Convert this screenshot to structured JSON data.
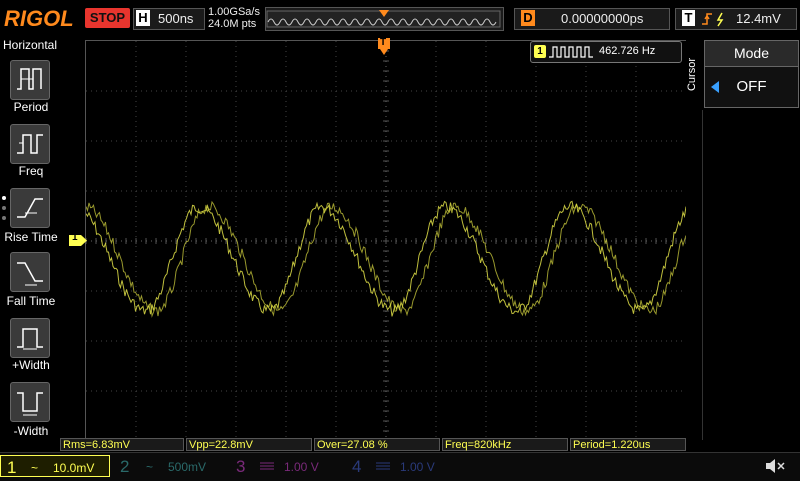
{
  "top": {
    "logo": "RIGOL",
    "run_state": "STOP",
    "timebase_label": "H",
    "timebase_value": "500ns",
    "sample_rate": "1.00GSa/s",
    "memory_points": "24.0M pts",
    "delay_label": "D",
    "delay_value": "0.00000000ps",
    "trigger_label": "T",
    "trigger_level": "12.4mV"
  },
  "menu": {
    "title": "Horizontal",
    "items": [
      {
        "label": "Period"
      },
      {
        "label": "Freq"
      },
      {
        "label": "Rise Time"
      },
      {
        "label": "Fall Time"
      },
      {
        "label": "+Width"
      },
      {
        "label": "-Width"
      }
    ]
  },
  "right_panel": {
    "vertical_label": "Cursor",
    "mode_title": "Mode",
    "mode_value": "OFF"
  },
  "freq_counter": {
    "channel": "1",
    "value": "462.726 Hz"
  },
  "markers": {
    "trigger_pos": "T",
    "ch1_ground": "1",
    "trigger_level_marker": "T"
  },
  "measurements": [
    "Rms=6.83mV",
    "Vpp=22.8mV",
    "Over=27.08 %",
    "Freq=820kHz",
    "Period=1.220us"
  ],
  "channels": [
    {
      "num": "1",
      "coupling": "~",
      "scale": "10.0mV",
      "color": "#ffff52"
    },
    {
      "num": "2",
      "coupling": "~",
      "scale": "500mV",
      "color": "#2a6a6a"
    },
    {
      "num": "3",
      "coupling": "",
      "scale": "1.00 V",
      "color": "#7a2a7a"
    },
    {
      "num": "4",
      "coupling": "",
      "scale": "1.00 V",
      "color": "#2a3a7a"
    }
  ],
  "colors": {
    "ch1": "#ffff52",
    "accent": "#ff8a1d",
    "stop": "#e8352e"
  },
  "waveform": {
    "channel": "1",
    "cycles_visible": 5
  }
}
